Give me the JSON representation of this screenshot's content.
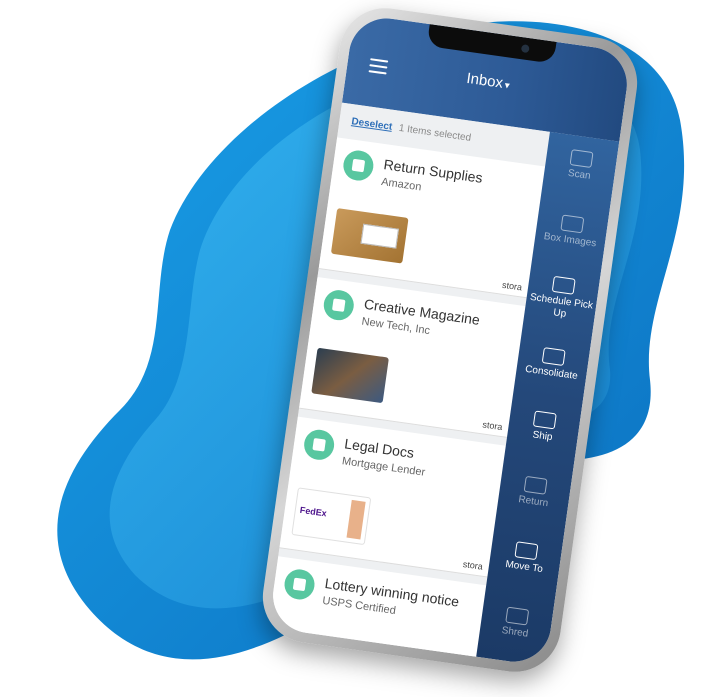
{
  "app": {
    "title": "Inbox",
    "title_caret": "▾"
  },
  "selection": {
    "deselect_label": "Deselect",
    "status_text": "1 Items selected"
  },
  "cards": [
    {
      "name": "Return Supplies",
      "sub": "Amazon",
      "thumb_kind": "box",
      "location": "stora"
    },
    {
      "name": "Creative Magazine",
      "sub": "New Tech, Inc",
      "thumb_kind": "magazine",
      "location": "stora"
    },
    {
      "name": "Legal Docs",
      "sub": "Mortgage Lender",
      "thumb_kind": "envelope",
      "location": "stora"
    },
    {
      "name": "Lottery winning notice",
      "sub": "USPS Certified",
      "thumb_kind": "letter",
      "location": ""
    }
  ],
  "side_menu": [
    {
      "label": "Scan",
      "icon": "scanner-icon",
      "enabled": false
    },
    {
      "label": "Box Images",
      "icon": "image-icon",
      "enabled": false
    },
    {
      "label": "Schedule Pick Up",
      "icon": "truck-icon",
      "enabled": true
    },
    {
      "label": "Consolidate",
      "icon": "boxes-icon",
      "enabled": true
    },
    {
      "label": "Ship",
      "icon": "package-icon",
      "enabled": true
    },
    {
      "label": "Return",
      "icon": "return-envelope-icon",
      "enabled": false
    },
    {
      "label": "Move To",
      "icon": "hand-truck-icon",
      "enabled": true
    },
    {
      "label": "Shred",
      "icon": "shredder-icon",
      "enabled": false
    }
  ],
  "colors": {
    "accent_green": "#58c7a0",
    "topbar_blue": "#2d5a96",
    "sidebar_blue": "#24487a",
    "link_blue": "#2e6fb8",
    "blob_blue": "#1a8fd8"
  }
}
